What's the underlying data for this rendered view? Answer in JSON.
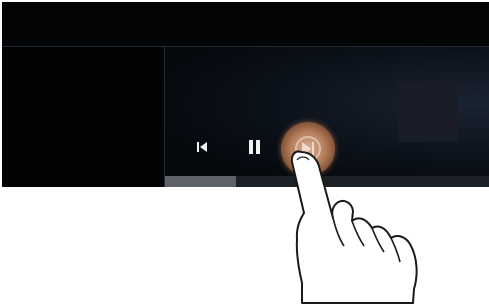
{
  "player": {
    "controls": {
      "previous": {
        "icon": "skip-previous-icon"
      },
      "pause": {
        "icon": "pause-icon"
      },
      "next": {
        "icon": "skip-next-icon",
        "state": "pressed"
      }
    },
    "progress": {
      "fraction": 0.22
    }
  },
  "overlay": {
    "icon": "pointing-hand-icon"
  },
  "colors": {
    "background": "#07090d",
    "progress_fill": "#5e6369",
    "pressed_button": "#b57f5c"
  }
}
